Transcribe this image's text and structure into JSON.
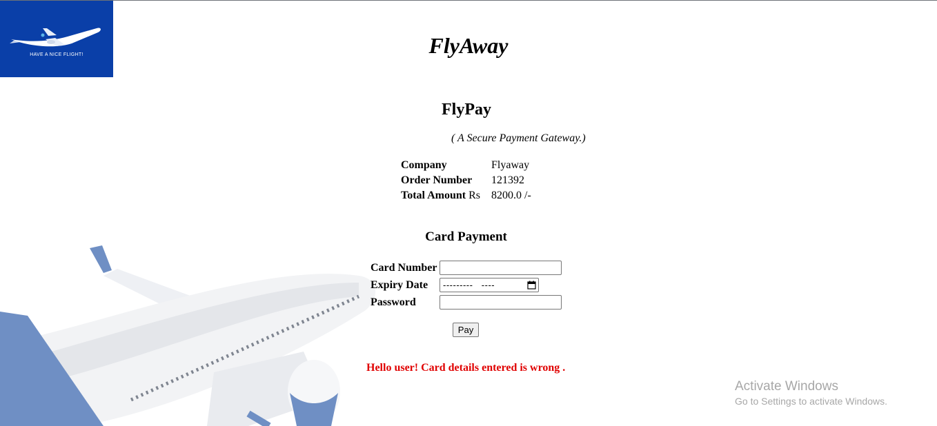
{
  "page": {
    "stray_char": ">",
    "site_title": "FlyAway",
    "logo_tagline": "HAVE A NICE FLIGHT!"
  },
  "payment": {
    "title": "FlyPay",
    "subtitle": "( A Secure Payment Gateway.)",
    "details": [
      {
        "label": "Company",
        "suffix": "",
        "value": "Flyaway"
      },
      {
        "label": "Order Number",
        "suffix": "",
        "value": "121392"
      },
      {
        "label": "Total Amount",
        "suffix": " Rs",
        "value": "8200.0 /-"
      }
    ]
  },
  "card_form": {
    "title": "Card Payment",
    "card_number_label": "Card Number",
    "card_number_value": "",
    "expiry_label": "Expiry Date",
    "expiry_placeholder": "---------   ----",
    "password_label": "Password",
    "password_value": "",
    "submit_label": "Pay"
  },
  "error_message": "Hello user! Card details entered is wrong .",
  "os_watermark": {
    "title": "Activate Windows",
    "subtitle": "Go to Settings to activate Windows."
  },
  "colors": {
    "logo_bg": "#0a3fa8",
    "error": "#e00000",
    "plane_accent": "#6f8fc4"
  },
  "icons": {
    "logo": "airplane-logo-icon",
    "background": "airplane-background-image",
    "date_picker": "calendar-icon"
  }
}
